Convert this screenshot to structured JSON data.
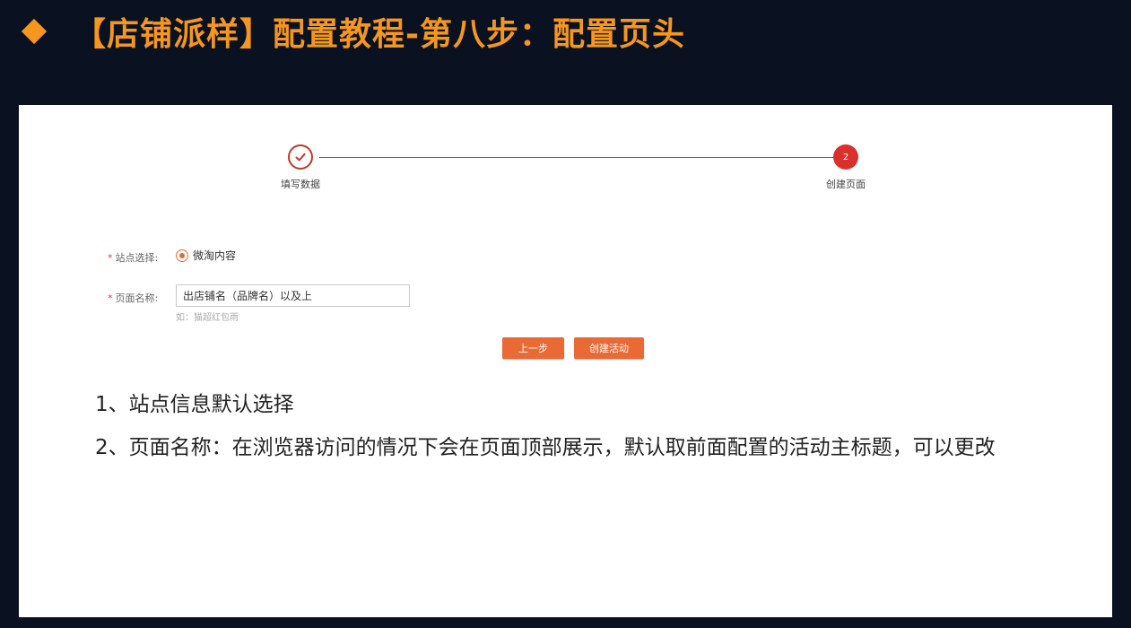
{
  "slide": {
    "title": "【店铺派样】配置教程-第八步：配置页头",
    "title_icon": "diamond-bullet-icon",
    "accent_color": "#f5961e",
    "background_color": "#0a1120"
  },
  "stepper": {
    "steps": [
      {
        "label": "填写数据",
        "state": "completed",
        "icon": "check-icon"
      },
      {
        "number": "2",
        "label": "创建页面",
        "state": "active"
      }
    ]
  },
  "form": {
    "site": {
      "label": "站点选择:",
      "option_label": "微淘内容",
      "selected": true
    },
    "page_name": {
      "label": "页面名称:",
      "value": "出店铺名（品牌名）以及上",
      "hint": "如：猫超红包雨"
    },
    "required_mark": "*"
  },
  "actions": {
    "prev_label": "上一步",
    "create_label": "创建活动",
    "button_color": "#ea6a35"
  },
  "notes": [
    "1、站点信息默认选择",
    "2、页面名称：在浏览器访问的情况下会在页面顶部展示，默认取前面配置的活动主标题，可以更改"
  ]
}
